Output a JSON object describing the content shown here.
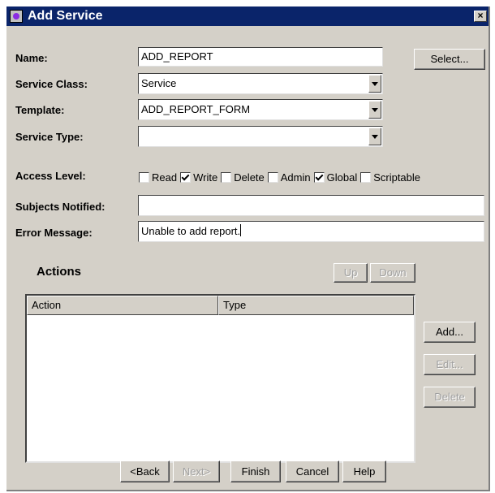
{
  "window": {
    "title": "Add Service",
    "close_glyph": "×"
  },
  "form": {
    "name_label": "Name:",
    "name_value": "ADD_REPORT",
    "select_button": "Select...",
    "service_class_label": "Service Class:",
    "service_class_value": "Service",
    "template_label": "Template:",
    "template_value": "ADD_REPORT_FORM",
    "service_type_label": "Service Type:",
    "service_type_value": "",
    "access_level_label": "Access Level:",
    "access_levels": [
      {
        "label": "Read",
        "checked": false
      },
      {
        "label": "Write",
        "checked": true
      },
      {
        "label": "Delete",
        "checked": false
      },
      {
        "label": "Admin",
        "checked": false
      },
      {
        "label": "Global",
        "checked": true
      },
      {
        "label": "Scriptable",
        "checked": false
      }
    ],
    "subjects_label": "Subjects Notified:",
    "subjects_value": "",
    "error_label": "Error Message:",
    "error_value": "Unable to add report."
  },
  "actions": {
    "heading": "Actions",
    "up_button": "Up",
    "down_button": "Down",
    "columns": [
      "Action",
      "Type"
    ],
    "add_button": "Add...",
    "edit_button": "Edit...",
    "delete_button": "Delete"
  },
  "footer": {
    "back_button": "<Back",
    "next_button": "Next>",
    "finish_button": "Finish",
    "cancel_button": "Cancel",
    "help_button": "Help"
  }
}
